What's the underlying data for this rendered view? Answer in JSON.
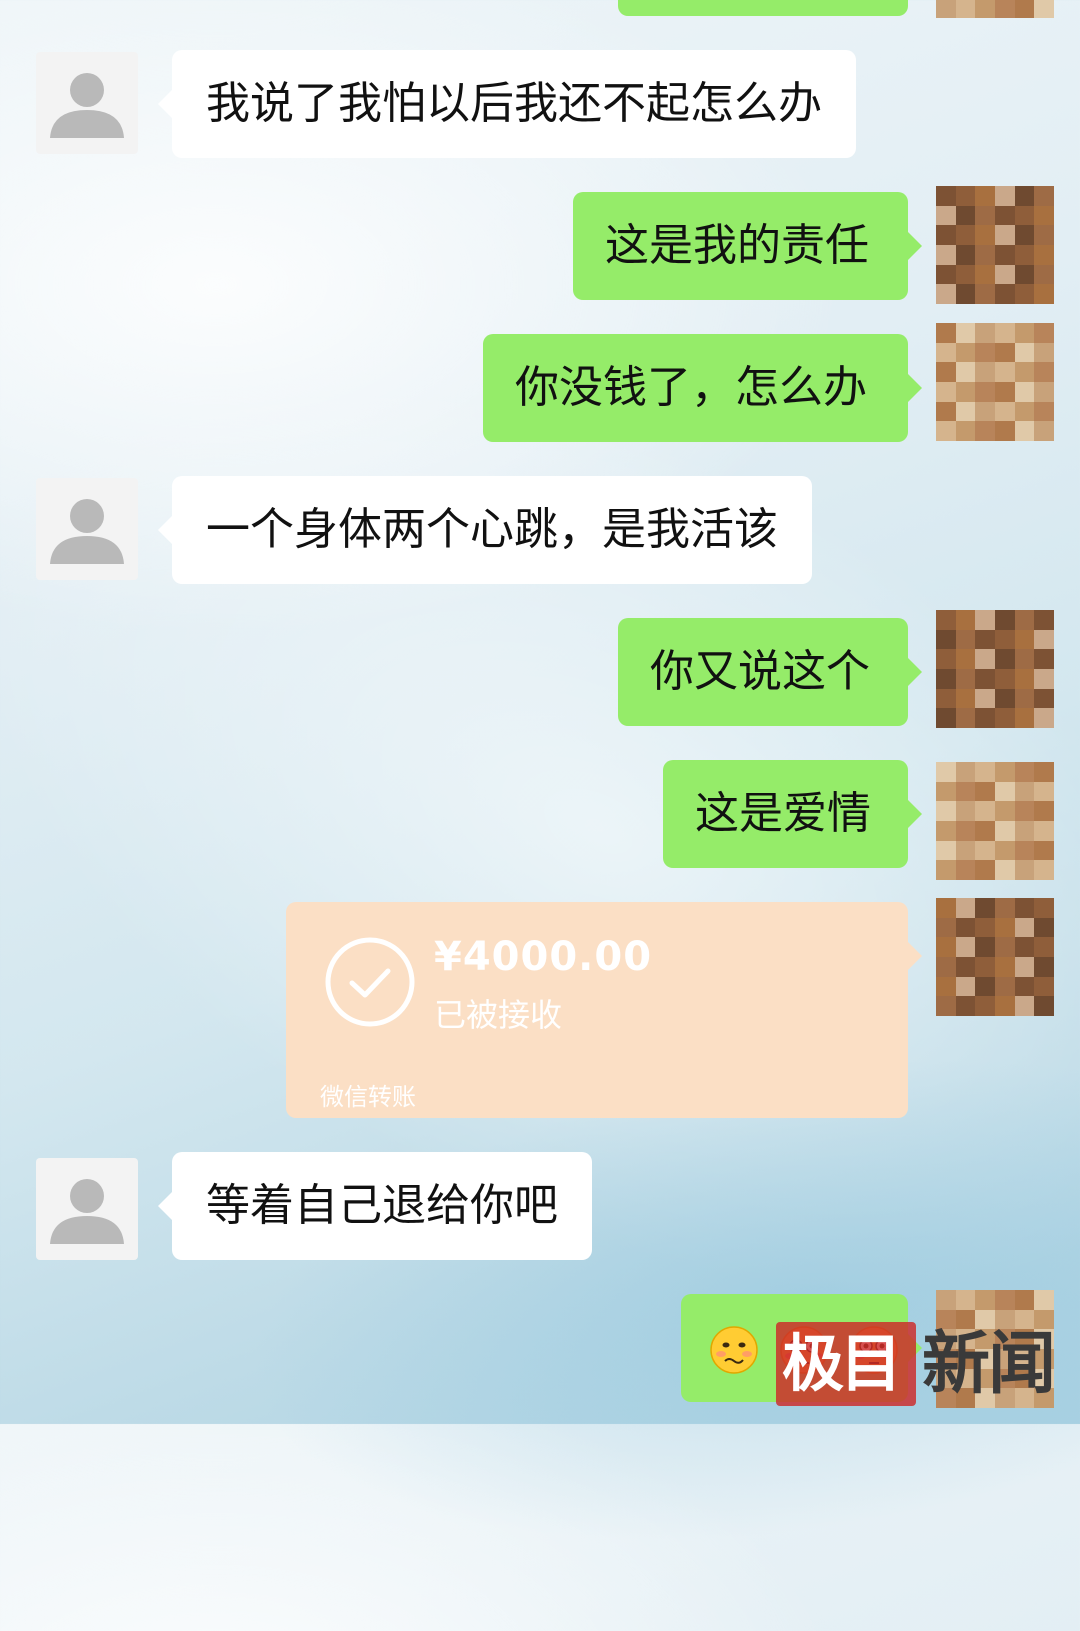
{
  "messages": [
    {
      "side": "them",
      "text": "我说了我怕以后我还不起怎么办"
    },
    {
      "side": "me",
      "text": "这是我的责任"
    },
    {
      "side": "me",
      "text": "你没钱了，怎么办"
    },
    {
      "side": "them",
      "text": "一个身体两个心跳，是我活该"
    },
    {
      "side": "me",
      "text": "你又说这个"
    },
    {
      "side": "me",
      "text": "这是爱情"
    },
    {
      "side": "them",
      "text": "等着自己退给你吧"
    }
  ],
  "transfer": {
    "amount": "¥4000.00",
    "status": "已被接收",
    "label": "微信转账"
  },
  "last_message": {
    "side": "me",
    "emoji": [
      "woozy-face",
      "flushed-face",
      "flushed-face"
    ]
  },
  "watermark": {
    "left": "极目",
    "right": "新闻"
  },
  "colors": {
    "bubble_me": "#95ec69",
    "bubble_them": "#ffffff",
    "transfer_bg": "#fbdfc5",
    "watermark_red": "#cd2828"
  }
}
